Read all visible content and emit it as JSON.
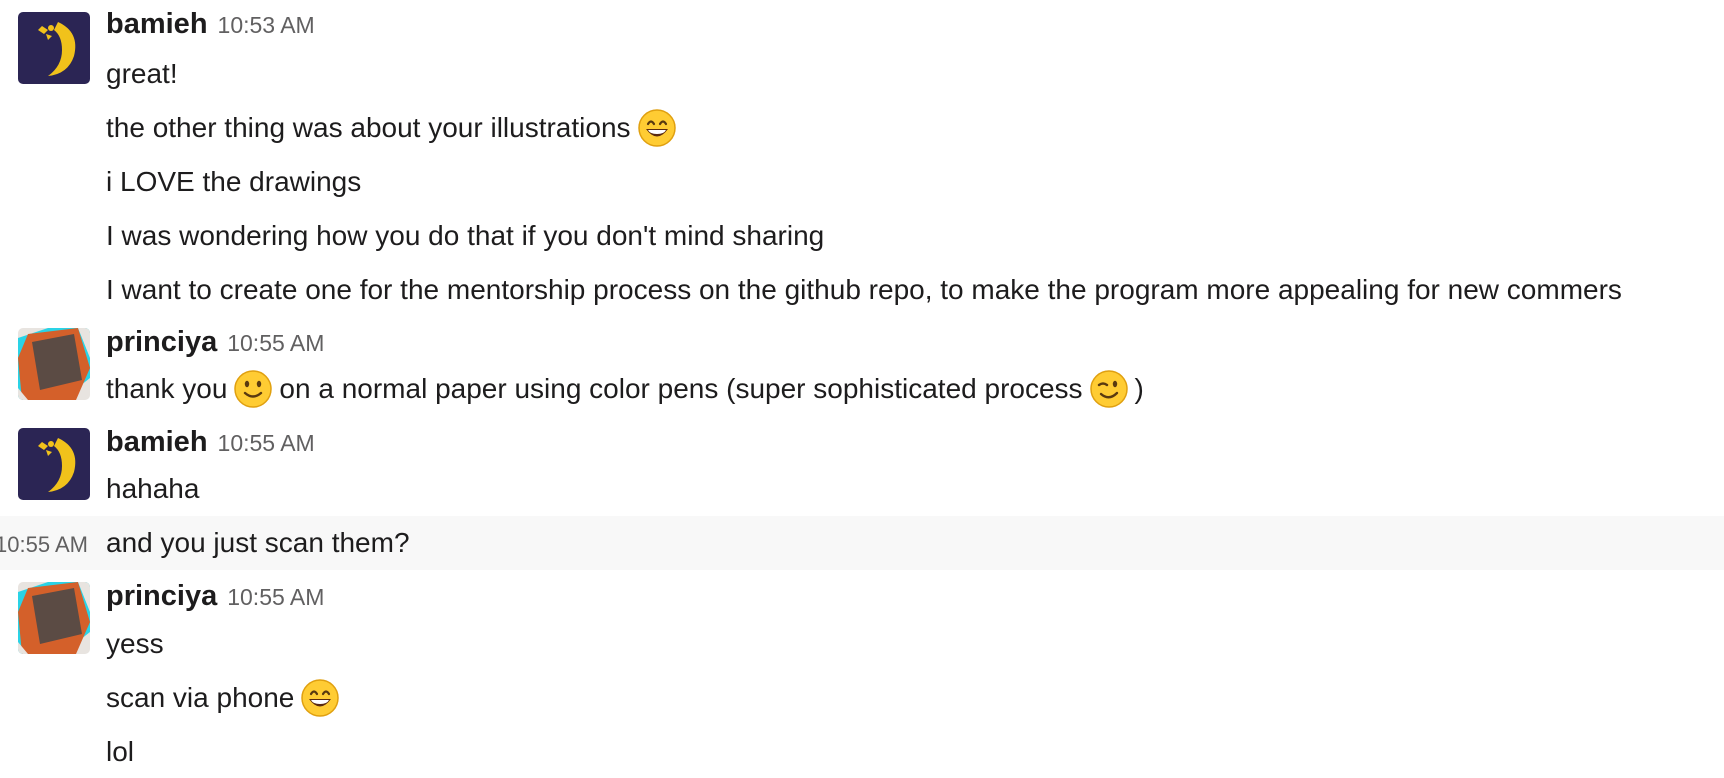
{
  "messages": [
    {
      "author": "bamieh",
      "time": "10:53 AM",
      "avatar": "bamieh-avatar",
      "lines": [
        "great!",
        "the other thing was about your illustrations",
        "i LOVE the drawings",
        "I was wondering how you do that if you don't mind sharing",
        "I want to create one for the mentorship process on the github repo, to make the program more appealing for new commers"
      ]
    },
    {
      "author": "princiya",
      "time": "10:55 AM",
      "avatar": "princiya-avatar",
      "lines": [
        [
          "thank you",
          "on a normal paper using color pens (super sophisticated process",
          ")"
        ]
      ]
    },
    {
      "author": "bamieh",
      "time": "10:55 AM",
      "avatar": "bamieh-avatar",
      "lines": [
        "hahaha"
      ]
    },
    {
      "hover_time": "10:55 AM",
      "lines": [
        "and you just scan them?"
      ]
    },
    {
      "author": "princiya",
      "time": "10:55 AM",
      "avatar": "princiya-avatar",
      "lines": [
        "yess",
        "scan via phone",
        "lol"
      ]
    }
  ],
  "emojis": {
    "grinning": "grinning-face-emoji",
    "slight_smile": "slightly-smiling-face-emoji",
    "wink": "winking-face-emoji"
  },
  "colors": {
    "bamieh_avatar_bg": "#2b2554",
    "bamieh_avatar_fg": "#f1c21b",
    "princiya_cyan": "#2ad3e6",
    "princiya_orange": "#d4602a",
    "princiya_dark": "#5b4b44",
    "hover_bg": "#f8f8f8",
    "timestamp": "#616061"
  }
}
